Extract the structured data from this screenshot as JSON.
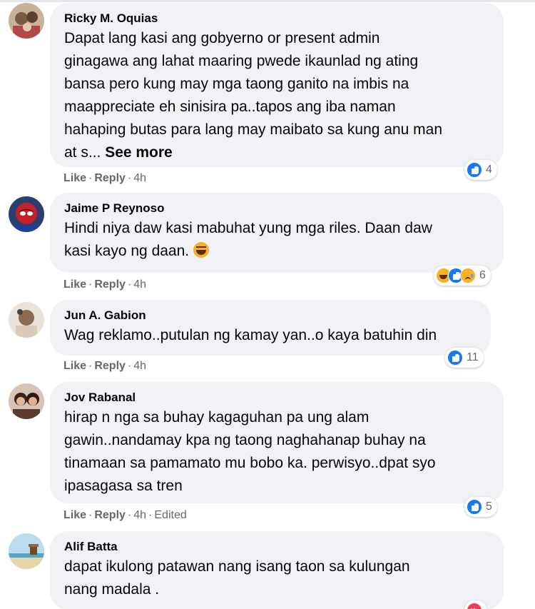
{
  "comments": [
    {
      "author": "Ricky M. Oquias",
      "text_lines": [
        "Dapat lang kasi ang gobyerno or present admin",
        "ginagawa ang lahat maaring pwede ikaunlad ng ating",
        "bansa pero kung may mga taong ganito na imbis na",
        "maappreciate eh sinisira pa..tapos ang iba naman",
        "hahaping butas para lang may maibato sa kung anu man",
        "at s... "
      ],
      "see_more": "See more",
      "like": "Like",
      "reply": "Reply",
      "time": "4h",
      "reactions": [
        "like-icon"
      ],
      "reaction_count": "4"
    },
    {
      "author": "Jaime P Reynoso",
      "text_lines": [
        "Hindi niya daw kasi mabuhat yung mga riles. Daan daw",
        "kasi kayo ng daan. "
      ],
      "emoji": "laughing-emoji-icon",
      "like": "Like",
      "reply": "Reply",
      "time": "4h",
      "reactions": [
        "haha-icon",
        "like-icon",
        "sad-icon"
      ],
      "reaction_count": "6"
    },
    {
      "author": "Jun A. Gabion",
      "text_lines": [
        "Wag reklamo..putulan ng kamay yan..o kaya batuhin din"
      ],
      "like": "Like",
      "reply": "Reply",
      "time": "4h",
      "reactions": [
        "like-icon"
      ],
      "reaction_count": "11"
    },
    {
      "author": "Jov Rabanal",
      "text_lines": [
        "hirap n nga sa buhay kagaguhan pa ung alam",
        "gawin..nandamay kpa ng taong naghahanap buhay na",
        "tinamaan sa pamamato mu bobo ka. perwisyo..dpat syo",
        "ipasagasa sa tren"
      ],
      "like": "Like",
      "reply": "Reply",
      "time": "4h",
      "edited": "Edited",
      "reactions": [
        "like-icon"
      ],
      "reaction_count": "5"
    },
    {
      "author": "Alif Batta",
      "text_lines": [
        "dapat ikulong patawan nang isang taon sa kulungan",
        "nang madala ."
      ],
      "reactions": [
        "love-icon"
      ]
    }
  ],
  "colors": {
    "bubble": "#f0f2f5",
    "meta": "#65676b",
    "like_blue": "#1877f2",
    "emoji_yellow": "#f7b125",
    "love_red": "#f33e58"
  }
}
